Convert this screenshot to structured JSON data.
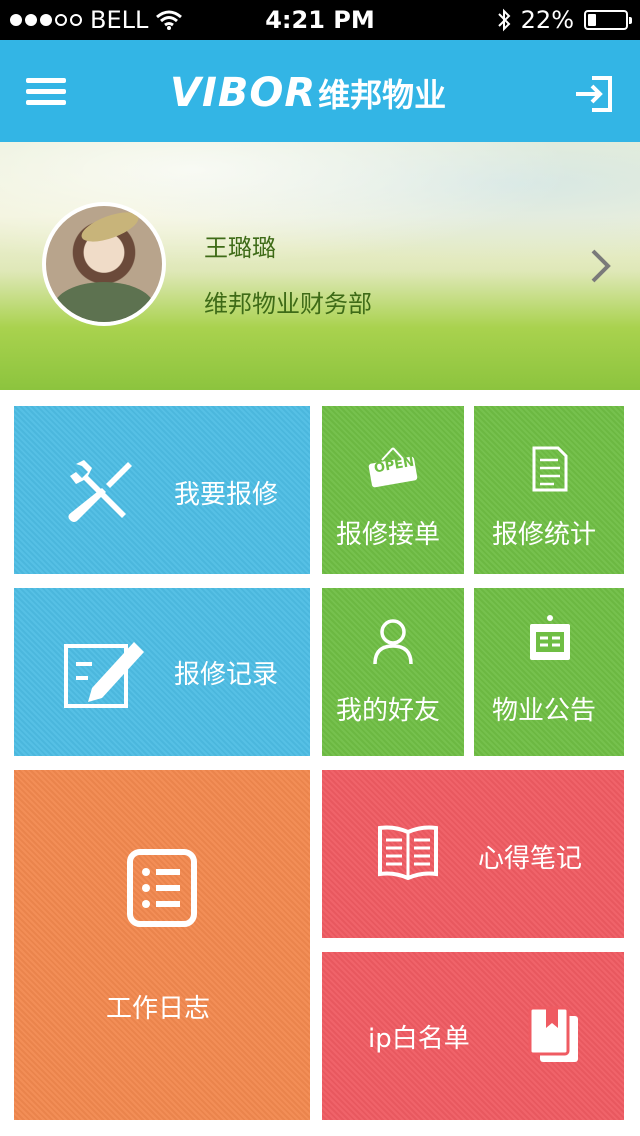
{
  "status_bar": {
    "carrier": "BELL",
    "time": "4:21 PM",
    "battery": "22%",
    "signal_bars_filled": 3,
    "signal_bars_total": 5
  },
  "nav": {
    "brand_en": "VIBOR",
    "brand_cn": "维邦物业",
    "menu_icon": "hamburger-icon",
    "logout_icon": "logout-icon",
    "bar_color": "#33b5e5"
  },
  "profile": {
    "name": "王璐璐",
    "department": "维邦物业财务部",
    "arrow_icon": "chevron-right-icon"
  },
  "tiles": {
    "repair_request": {
      "label": "我要报修",
      "icon": "tools-icon",
      "color": "#4dbde4"
    },
    "repair_accept": {
      "label": "报修接单",
      "icon": "open-sign-icon",
      "icon_text": "OPEN",
      "color": "#6fbe44"
    },
    "repair_stats": {
      "label": "报修统计",
      "icon": "document-icon",
      "color": "#6fbe44"
    },
    "repair_records": {
      "label": "报修记录",
      "icon": "edit-icon",
      "color": "#4dbde4"
    },
    "my_friends": {
      "label": "我的好友",
      "icon": "user-icon",
      "color": "#6fbe44"
    },
    "notices": {
      "label": "物业公告",
      "icon": "noticeboard-icon",
      "color": "#6fbe44"
    },
    "work_log": {
      "label": "工作日志",
      "icon": "list-icon",
      "color": "#f2884e"
    },
    "notes": {
      "label": "心得笔记",
      "icon": "open-book-icon",
      "color": "#ef5b62"
    },
    "ip_whitelist": {
      "label": "ip白名单",
      "icon": "bookmark-book-icon",
      "color": "#ef5b62"
    }
  }
}
